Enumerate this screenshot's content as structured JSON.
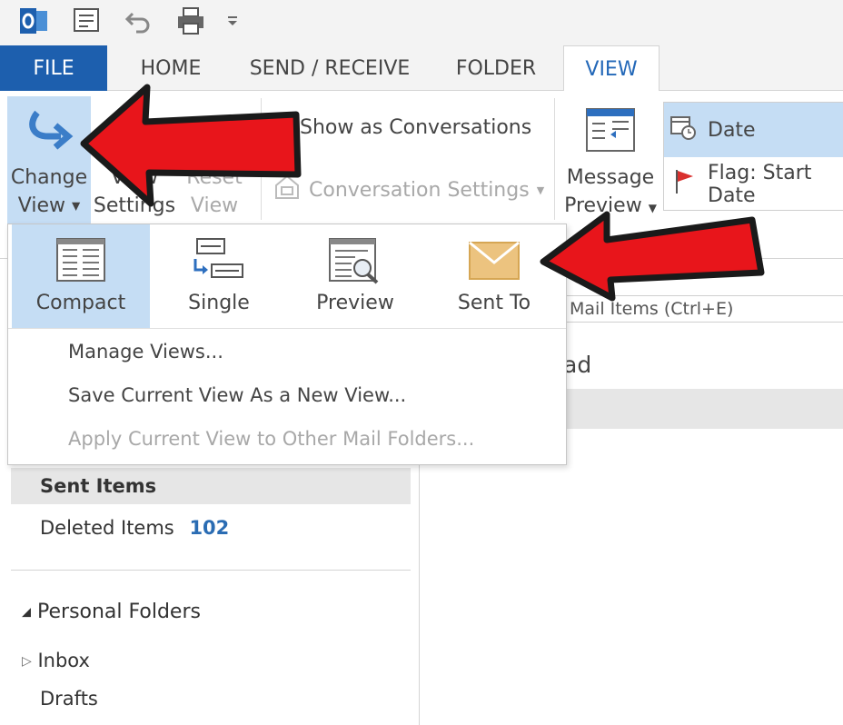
{
  "tabs": {
    "file": "FILE",
    "home": "HOME",
    "send_receive": "SEND / RECEIVE",
    "folder": "FOLDER",
    "view": "VIEW"
  },
  "ribbon": {
    "change_view_line1": "Change",
    "change_view_line2": "View",
    "view_settings_line1": "View",
    "view_settings_line2": "Settings",
    "reset_view_line1": "Reset",
    "reset_view_line2": "View",
    "show_as_conversations": "Show as Conversations",
    "conversation_settings": "Conversation Settings",
    "message_preview_line1": "Message",
    "message_preview_line2": "Preview",
    "arrangement_date": "Date",
    "arrangement_flag_start": "Flag: Start Date"
  },
  "dropdown": {
    "views": [
      {
        "label": "Compact",
        "selected": true
      },
      {
        "label": "Single"
      },
      {
        "label": "Preview"
      },
      {
        "label": "Sent To"
      }
    ],
    "manage_views": "Manage Views...",
    "save_view": "Save Current View As a New View...",
    "apply_view": "Apply Current View to Other Mail Folders..."
  },
  "search": {
    "placeholder": "Mail Items (Ctrl+E)"
  },
  "list": {
    "header_fragment": "ad"
  },
  "nav": {
    "sent_items": "Sent Items",
    "deleted_items": "Deleted Items",
    "deleted_count": "102",
    "personal_folders": "Personal Folders",
    "inbox": "Inbox",
    "drafts": "Drafts"
  },
  "colors": {
    "accent": "#1d5fae",
    "selected_bg": "#c5ddf4",
    "arrow_red": "#e8151b",
    "count_blue": "#2a6cb3"
  }
}
